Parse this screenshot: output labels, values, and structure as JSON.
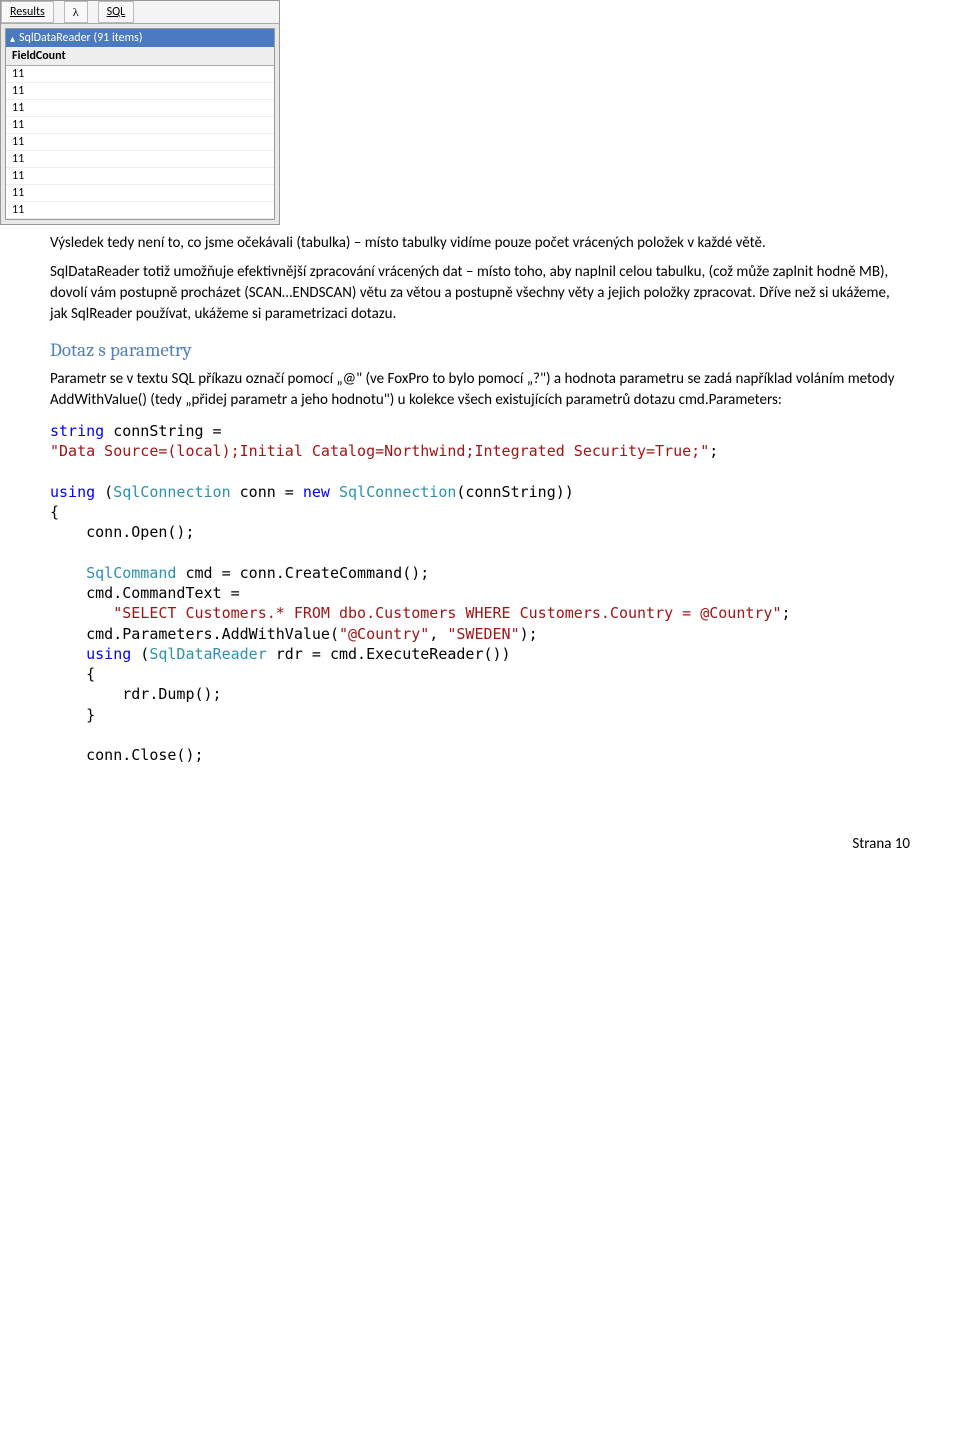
{
  "screenshot": {
    "tab_results": "Results",
    "tab_lambda": "λ",
    "tab_sql": "SQL",
    "reader_header": "SqlDataReader (91 items)",
    "column_header": "FieldCount",
    "rows": [
      "11",
      "11",
      "11",
      "11",
      "11",
      "11",
      "11",
      "11",
      "11"
    ]
  },
  "para1": "Výsledek tedy není to, co jsme očekávali (tabulka) – místo tabulky vidíme pouze počet vrácených položek v každé větě.",
  "para2": "SqlDataReader totiž umožňuje efektivnější zpracování vrácených dat – místo toho, aby naplnil celou tabulku, (což může zaplnit hodně MB), dovolí vám postupně procházet (SCAN…ENDSCAN) větu za větou a postupně všechny věty a jejich položky zpracovat. Dříve než si ukážeme, jak SqlReader používat, ukážeme si parametrizaci dotazu.",
  "heading": "Dotaz s parametry",
  "para3": "Parametr se v textu SQL příkazu označí pomocí „@\" (ve FoxPro to bylo pomocí „?\") a hodnota parametru se zadá například voláním metody AddWithValue() (tedy „přidej parametr a jeho hodnotu\") u kolekce všech existujících parametrů dotazu cmd.Parameters:",
  "code": {
    "line1a": "string",
    "line1b": " connString =",
    "line2": "\"Data Source=(local);Initial Catalog=Northwind;Integrated Security=True;\"",
    "line2b": ";",
    "line4a": "using",
    "line4b": " (",
    "line4c": "SqlConnection",
    "line4d": " conn = ",
    "line4e": "new",
    "line4f": " ",
    "line4g": "SqlConnection",
    "line4h": "(connString))",
    "line5": "{",
    "line6": "    conn.Open();",
    "line8a": "    ",
    "line8b": "SqlCommand",
    "line8c": " cmd = conn.CreateCommand();",
    "line9": "    cmd.CommandText =",
    "line10a": "       ",
    "line10b": "\"SELECT Customers.* FROM dbo.Customers WHERE Customers.Country = @Country\"",
    "line10c": ";",
    "line11a": "    cmd.Parameters.AddWithValue(",
    "line11b": "\"@Country\"",
    "line11c": ", ",
    "line11d": "\"SWEDEN\"",
    "line11e": ");",
    "line12a": "    ",
    "line12b": "using",
    "line12c": " (",
    "line12d": "SqlDataReader",
    "line12e": " rdr = cmd.ExecuteReader())",
    "line13": "    {",
    "line14": "        rdr.Dump();",
    "line15": "    }",
    "line17": "    conn.Close();"
  },
  "footer": "Strana 10"
}
